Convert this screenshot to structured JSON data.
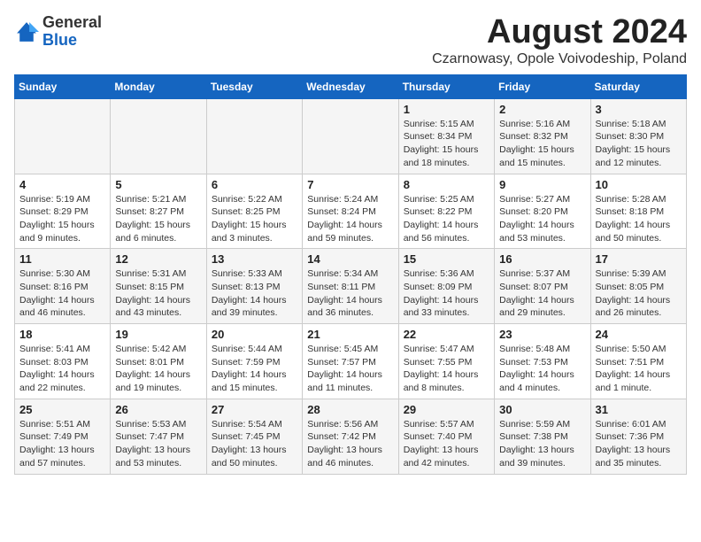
{
  "logo": {
    "general": "General",
    "blue": "Blue"
  },
  "title": "August 2024",
  "subtitle": "Czarnowasy, Opole Voivodeship, Poland",
  "weekdays": [
    "Sunday",
    "Monday",
    "Tuesday",
    "Wednesday",
    "Thursday",
    "Friday",
    "Saturday"
  ],
  "weeks": [
    [
      {
        "day": "",
        "info": ""
      },
      {
        "day": "",
        "info": ""
      },
      {
        "day": "",
        "info": ""
      },
      {
        "day": "",
        "info": ""
      },
      {
        "day": "1",
        "info": "Sunrise: 5:15 AM\nSunset: 8:34 PM\nDaylight: 15 hours\nand 18 minutes."
      },
      {
        "day": "2",
        "info": "Sunrise: 5:16 AM\nSunset: 8:32 PM\nDaylight: 15 hours\nand 15 minutes."
      },
      {
        "day": "3",
        "info": "Sunrise: 5:18 AM\nSunset: 8:30 PM\nDaylight: 15 hours\nand 12 minutes."
      }
    ],
    [
      {
        "day": "4",
        "info": "Sunrise: 5:19 AM\nSunset: 8:29 PM\nDaylight: 15 hours\nand 9 minutes."
      },
      {
        "day": "5",
        "info": "Sunrise: 5:21 AM\nSunset: 8:27 PM\nDaylight: 15 hours\nand 6 minutes."
      },
      {
        "day": "6",
        "info": "Sunrise: 5:22 AM\nSunset: 8:25 PM\nDaylight: 15 hours\nand 3 minutes."
      },
      {
        "day": "7",
        "info": "Sunrise: 5:24 AM\nSunset: 8:24 PM\nDaylight: 14 hours\nand 59 minutes."
      },
      {
        "day": "8",
        "info": "Sunrise: 5:25 AM\nSunset: 8:22 PM\nDaylight: 14 hours\nand 56 minutes."
      },
      {
        "day": "9",
        "info": "Sunrise: 5:27 AM\nSunset: 8:20 PM\nDaylight: 14 hours\nand 53 minutes."
      },
      {
        "day": "10",
        "info": "Sunrise: 5:28 AM\nSunset: 8:18 PM\nDaylight: 14 hours\nand 50 minutes."
      }
    ],
    [
      {
        "day": "11",
        "info": "Sunrise: 5:30 AM\nSunset: 8:16 PM\nDaylight: 14 hours\nand 46 minutes."
      },
      {
        "day": "12",
        "info": "Sunrise: 5:31 AM\nSunset: 8:15 PM\nDaylight: 14 hours\nand 43 minutes."
      },
      {
        "day": "13",
        "info": "Sunrise: 5:33 AM\nSunset: 8:13 PM\nDaylight: 14 hours\nand 39 minutes."
      },
      {
        "day": "14",
        "info": "Sunrise: 5:34 AM\nSunset: 8:11 PM\nDaylight: 14 hours\nand 36 minutes."
      },
      {
        "day": "15",
        "info": "Sunrise: 5:36 AM\nSunset: 8:09 PM\nDaylight: 14 hours\nand 33 minutes."
      },
      {
        "day": "16",
        "info": "Sunrise: 5:37 AM\nSunset: 8:07 PM\nDaylight: 14 hours\nand 29 minutes."
      },
      {
        "day": "17",
        "info": "Sunrise: 5:39 AM\nSunset: 8:05 PM\nDaylight: 14 hours\nand 26 minutes."
      }
    ],
    [
      {
        "day": "18",
        "info": "Sunrise: 5:41 AM\nSunset: 8:03 PM\nDaylight: 14 hours\nand 22 minutes."
      },
      {
        "day": "19",
        "info": "Sunrise: 5:42 AM\nSunset: 8:01 PM\nDaylight: 14 hours\nand 19 minutes."
      },
      {
        "day": "20",
        "info": "Sunrise: 5:44 AM\nSunset: 7:59 PM\nDaylight: 14 hours\nand 15 minutes."
      },
      {
        "day": "21",
        "info": "Sunrise: 5:45 AM\nSunset: 7:57 PM\nDaylight: 14 hours\nand 11 minutes."
      },
      {
        "day": "22",
        "info": "Sunrise: 5:47 AM\nSunset: 7:55 PM\nDaylight: 14 hours\nand 8 minutes."
      },
      {
        "day": "23",
        "info": "Sunrise: 5:48 AM\nSunset: 7:53 PM\nDaylight: 14 hours\nand 4 minutes."
      },
      {
        "day": "24",
        "info": "Sunrise: 5:50 AM\nSunset: 7:51 PM\nDaylight: 14 hours\nand 1 minute."
      }
    ],
    [
      {
        "day": "25",
        "info": "Sunrise: 5:51 AM\nSunset: 7:49 PM\nDaylight: 13 hours\nand 57 minutes."
      },
      {
        "day": "26",
        "info": "Sunrise: 5:53 AM\nSunset: 7:47 PM\nDaylight: 13 hours\nand 53 minutes."
      },
      {
        "day": "27",
        "info": "Sunrise: 5:54 AM\nSunset: 7:45 PM\nDaylight: 13 hours\nand 50 minutes."
      },
      {
        "day": "28",
        "info": "Sunrise: 5:56 AM\nSunset: 7:42 PM\nDaylight: 13 hours\nand 46 minutes."
      },
      {
        "day": "29",
        "info": "Sunrise: 5:57 AM\nSunset: 7:40 PM\nDaylight: 13 hours\nand 42 minutes."
      },
      {
        "day": "30",
        "info": "Sunrise: 5:59 AM\nSunset: 7:38 PM\nDaylight: 13 hours\nand 39 minutes."
      },
      {
        "day": "31",
        "info": "Sunrise: 6:01 AM\nSunset: 7:36 PM\nDaylight: 13 hours\nand 35 minutes."
      }
    ]
  ]
}
